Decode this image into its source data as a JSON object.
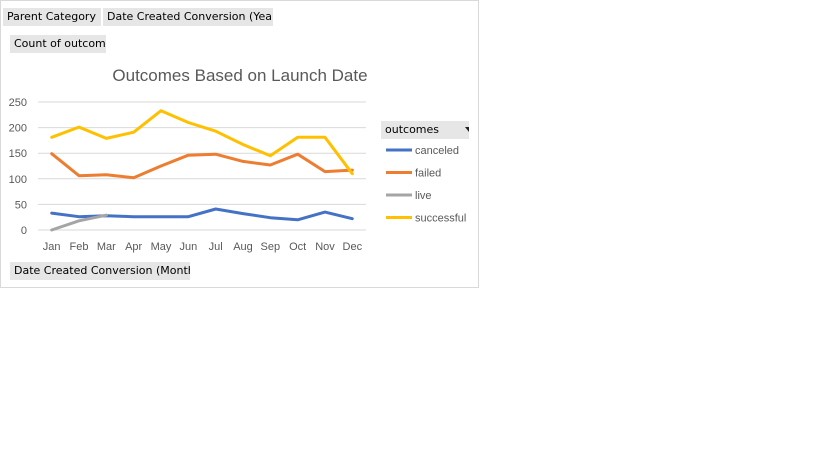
{
  "filters": {
    "parent_category": "Parent Category",
    "year": "Date Created Conversion (Year)",
    "value_field": "Count of outcomes",
    "axis_field": "Date Created Conversion (Month)",
    "legend_field": "outcomes"
  },
  "colors": {
    "canceled": "#4472c4",
    "failed": "#ed7d31",
    "live": "#a5a5a5",
    "successful": "#ffc000",
    "grid": "#d9d9d9",
    "text": "#595959"
  },
  "icons": {
    "dropdown": "chevron-down-icon"
  },
  "chart_data": {
    "type": "line",
    "title": "Outcomes Based on Launch Date",
    "xlabel": "",
    "ylabel": "",
    "categories": [
      "Jan",
      "Feb",
      "Mar",
      "Apr",
      "May",
      "Jun",
      "Jul",
      "Aug",
      "Sep",
      "Oct",
      "Nov",
      "Dec"
    ],
    "ylim": [
      0,
      250
    ],
    "yticks": [
      0,
      50,
      100,
      150,
      200,
      250
    ],
    "grid": true,
    "legend_position": "right",
    "series": [
      {
        "name": "canceled",
        "values": [
          33,
          26,
          28,
          26,
          26,
          26,
          41,
          32,
          24,
          20,
          35,
          22
        ]
      },
      {
        "name": "failed",
        "values": [
          149,
          106,
          108,
          102,
          125,
          146,
          148,
          134,
          127,
          148,
          114,
          117
        ]
      },
      {
        "name": "live",
        "values": [
          0,
          18,
          29,
          null,
          null,
          null,
          null,
          null,
          null,
          null,
          null,
          null
        ]
      },
      {
        "name": "successful",
        "values": [
          181,
          201,
          179,
          191,
          233,
          210,
          193,
          167,
          145,
          181,
          181,
          110
        ]
      }
    ]
  }
}
